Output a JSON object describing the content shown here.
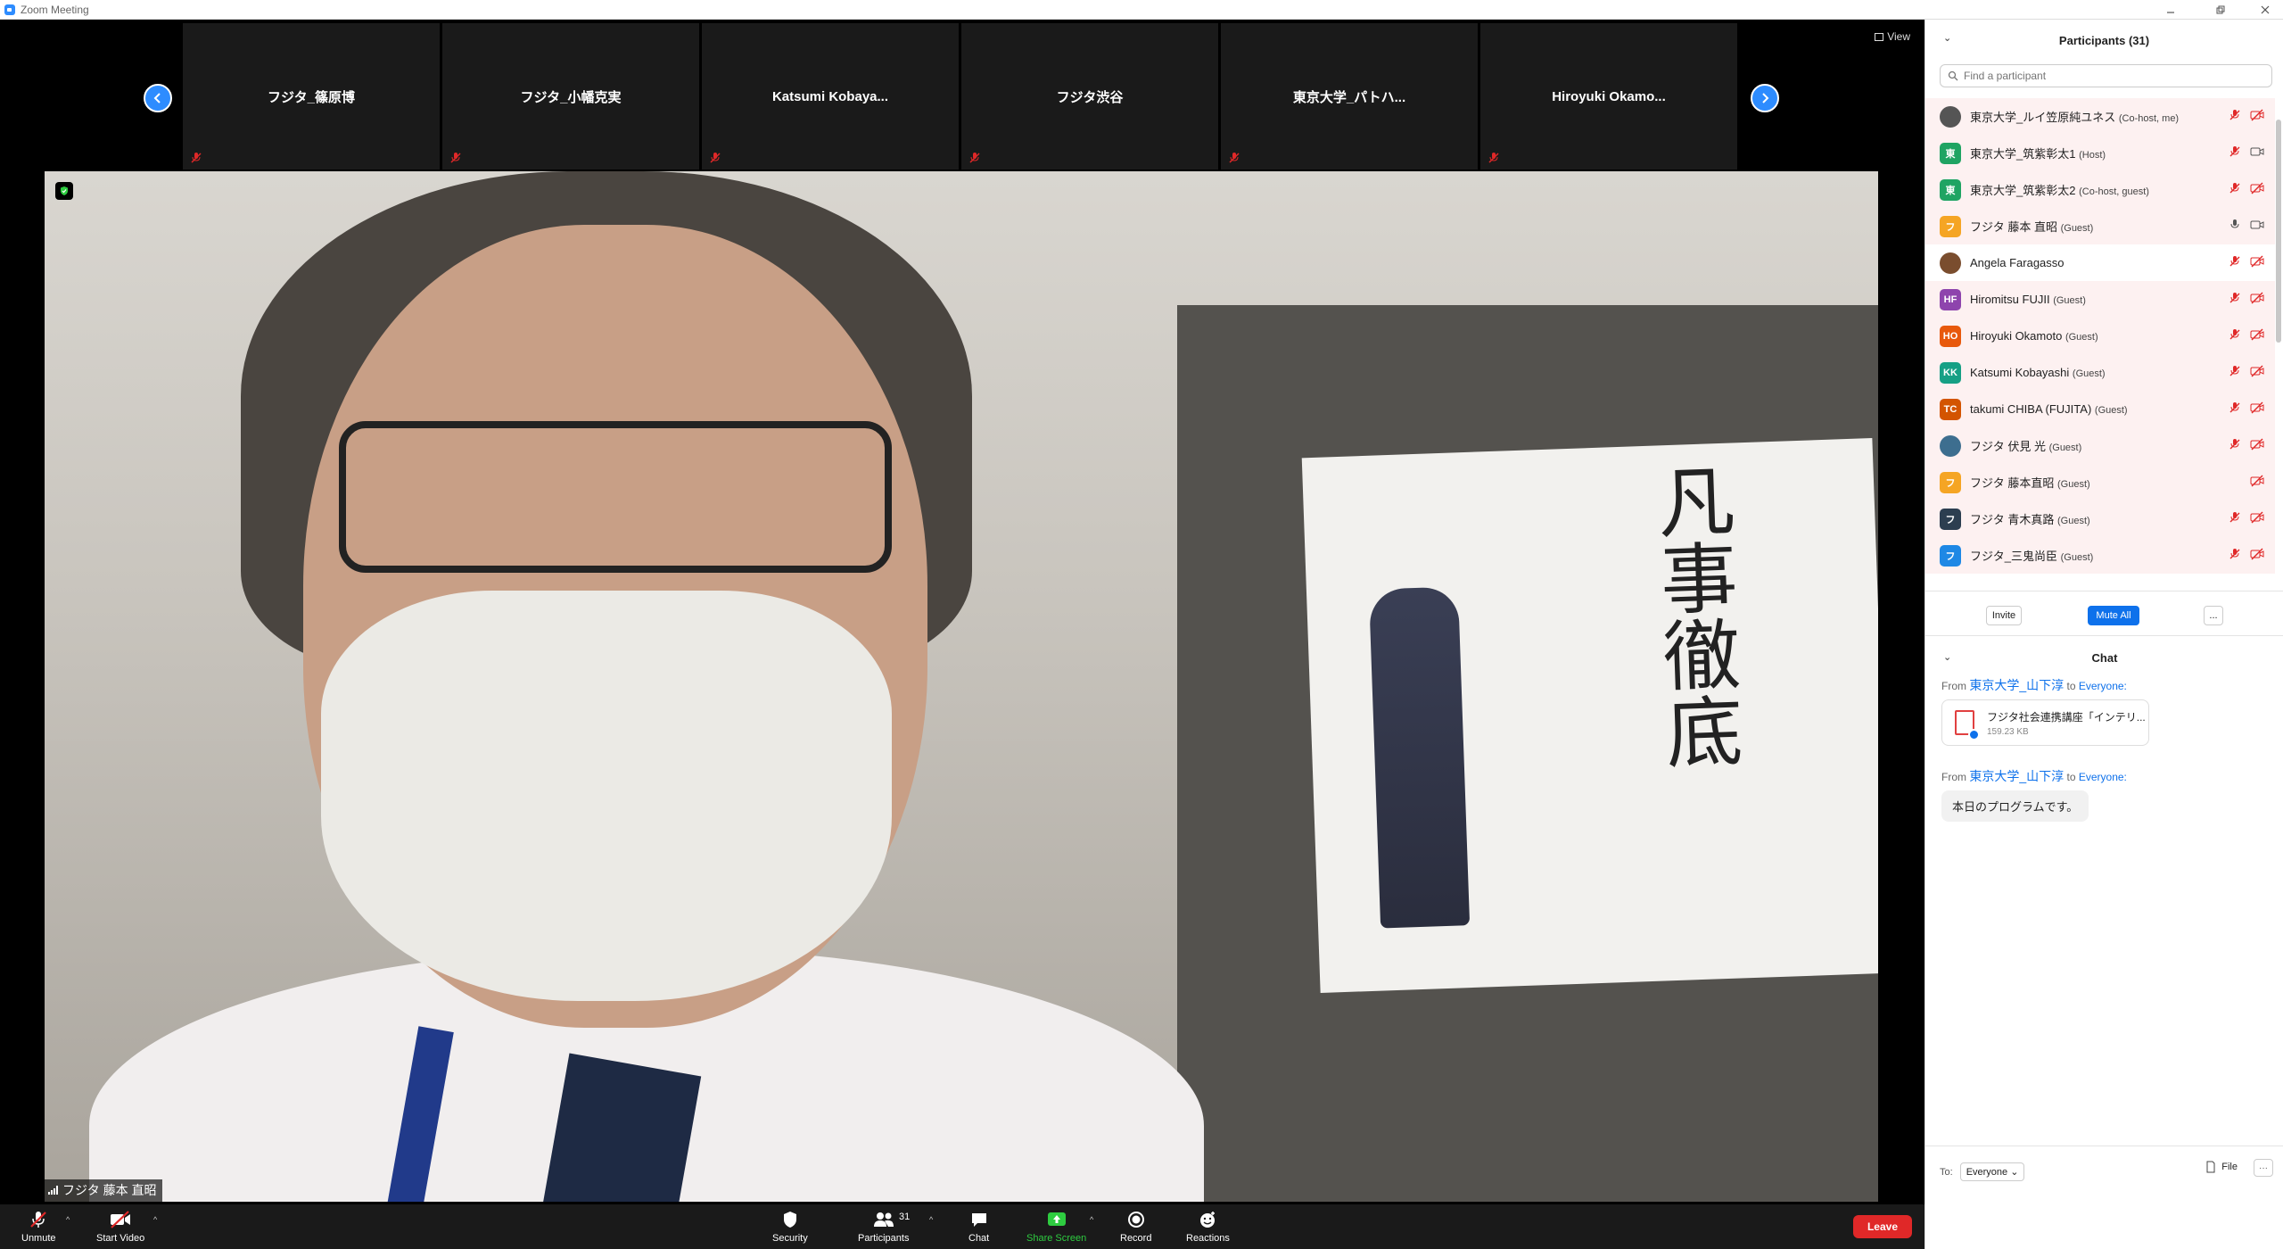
{
  "window": {
    "title": "Zoom Meeting"
  },
  "view": {
    "label": "View"
  },
  "gallery": {
    "tiles": [
      {
        "name": "フジタ_篠原博"
      },
      {
        "name": "フジタ_小幡克実"
      },
      {
        "name": "Katsumi  Kobaya..."
      },
      {
        "name": "フジタ渋谷"
      },
      {
        "name": "東京大学_パトハ..."
      },
      {
        "name": "Hiroyuki  Okamo..."
      }
    ]
  },
  "main_video": {
    "speaker_name": "フジタ 藤本 直昭",
    "poster_text": "凡事徹底"
  },
  "toolbar": {
    "unmute": "Unmute",
    "start_video": "Start Video",
    "security": "Security",
    "participants": "Participants",
    "participants_count": "31",
    "chat": "Chat",
    "share_screen": "Share Screen",
    "record": "Record",
    "reactions": "Reactions",
    "leave": "Leave"
  },
  "participants_panel": {
    "title": "Participants (31)",
    "search_placeholder": "Find a participant",
    "items": [
      {
        "avatar": "",
        "avatar_color": "#555555",
        "name": "東京大学_ルイ笠原純ユネス",
        "role": "(Co-host, me)"
      },
      {
        "avatar": "東",
        "avatar_color": "#1fa463",
        "name": "東京大学_筑紫彰太1",
        "role": "(Host)"
      },
      {
        "avatar": "東",
        "avatar_color": "#1fa463",
        "name": "東京大学_筑紫彰太2",
        "role": "(Co-host, guest)"
      },
      {
        "avatar": "フ",
        "avatar_color": "#f5a524",
        "name": "フジタ 藤本 直昭",
        "role": "(Guest)"
      },
      {
        "avatar": "",
        "avatar_color": "#7a4d2e",
        "name": "Angela Faragasso",
        "role": ""
      },
      {
        "avatar": "HF",
        "avatar_color": "#8e44ad",
        "name": "Hiromitsu FUJII",
        "role": "(Guest)"
      },
      {
        "avatar": "HO",
        "avatar_color": "#e8590c",
        "name": "Hiroyuki Okamoto",
        "role": "(Guest)"
      },
      {
        "avatar": "KK",
        "avatar_color": "#16a085",
        "name": "Katsumi Kobayashi",
        "role": "(Guest)"
      },
      {
        "avatar": "TC",
        "avatar_color": "#d35400",
        "name": "takumi CHIBA (FUJITA)",
        "role": "(Guest)"
      },
      {
        "avatar": "",
        "avatar_color": "#3d6e8f",
        "name": "フジタ 伏見 光",
        "role": "(Guest)"
      },
      {
        "avatar": "フ",
        "avatar_color": "#f5a524",
        "name": "フジタ  藤本直昭",
        "role": "(Guest)"
      },
      {
        "avatar": "フ",
        "avatar_color": "#2c3e50",
        "name": "フジタ  青木真路",
        "role": "(Guest)"
      },
      {
        "avatar": "フ",
        "avatar_color": "#1e88e5",
        "name": "フジタ_三鬼尚臣",
        "role": "(Guest)"
      }
    ],
    "invite": "Invite",
    "mute_all": "Mute All",
    "more": "..."
  },
  "chat": {
    "title": "Chat",
    "messages": [
      {
        "from_label": "From",
        "sender": "東京大学_山下淳",
        "to_label": "to",
        "recipient": "Everyone",
        "file_name": "フジタ社会連携講座「インテリ...",
        "file_size": "159.23 KB"
      },
      {
        "from_label": "From",
        "sender": "東京大学_山下淳",
        "to_label": "to",
        "recipient": "Everyone",
        "text": "本日のプログラムです。"
      }
    ],
    "to_label": "To:",
    "to_value": "Everyone",
    "file_button": "File",
    "more": "···"
  },
  "colors": {
    "accent": "#0e71eb",
    "leave": "#e02828",
    "share": "#2ecc40",
    "muted": "#e02828"
  }
}
